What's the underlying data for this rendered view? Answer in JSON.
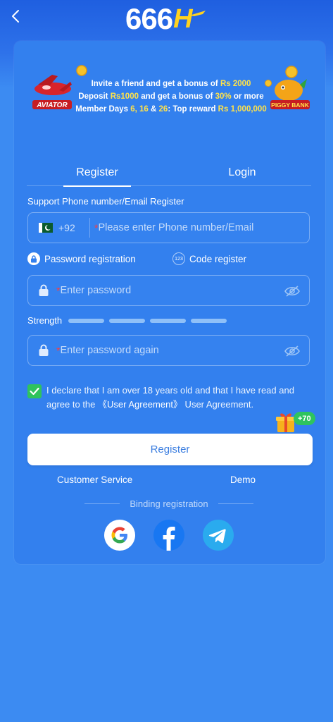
{
  "header": {
    "back_icon": "chevron-left-icon",
    "logo_main": "666",
    "logo_suffix": "H"
  },
  "banner": {
    "line1_prefix": "Invite a friend and get a bonus of ",
    "line1_amount": "Rs 2000",
    "line2_prefix": "Deposit ",
    "line2_amount": "Rs1000",
    "line2_mid": " and get a bonus of ",
    "line2_pct": "30%",
    "line2_suffix": " or more",
    "line3_prefix": "Member Days ",
    "line3_days_a": "6, 16",
    "line3_and": " & ",
    "line3_days_b": "26",
    "line3_mid": ": Top reward ",
    "line3_amount": "Rs 1,000,000",
    "aviator_label": "AVIATOR",
    "piggy_label": "PIGGY BANK"
  },
  "tabs": {
    "register": "Register",
    "login": "Login",
    "active": "Register"
  },
  "form": {
    "support_label": "Support Phone number/Email Register",
    "country_code": "+92",
    "phone_placeholder": "Please enter Phone number/Email",
    "mode_password": "Password registration",
    "mode_code": "Code register",
    "mode_code_icon_text": "123",
    "password_placeholder": "Enter password",
    "strength_label": "Strength",
    "password_again_placeholder": "Enter password again",
    "agreement_text": "I declare that I am over 18 years old and that I have read and agree to the ",
    "agreement_link": "《User Agreement》",
    "agreement_suffix": " User Agreement.",
    "agreement_checked": true,
    "gift_badge": "+70",
    "register_button": "Register"
  },
  "footer": {
    "customer_service": "Customer Service",
    "demo": "Demo",
    "binding_label": "Binding registration",
    "social": [
      "google-icon",
      "facebook-icon",
      "telegram-icon"
    ]
  },
  "colors": {
    "background": "#3c8bf2",
    "card": "#3380ee",
    "accent_yellow": "#ffe24a",
    "checkbox_green": "#2fc35d",
    "button_text": "#3d7fe0",
    "required": "#ff3b3b"
  }
}
